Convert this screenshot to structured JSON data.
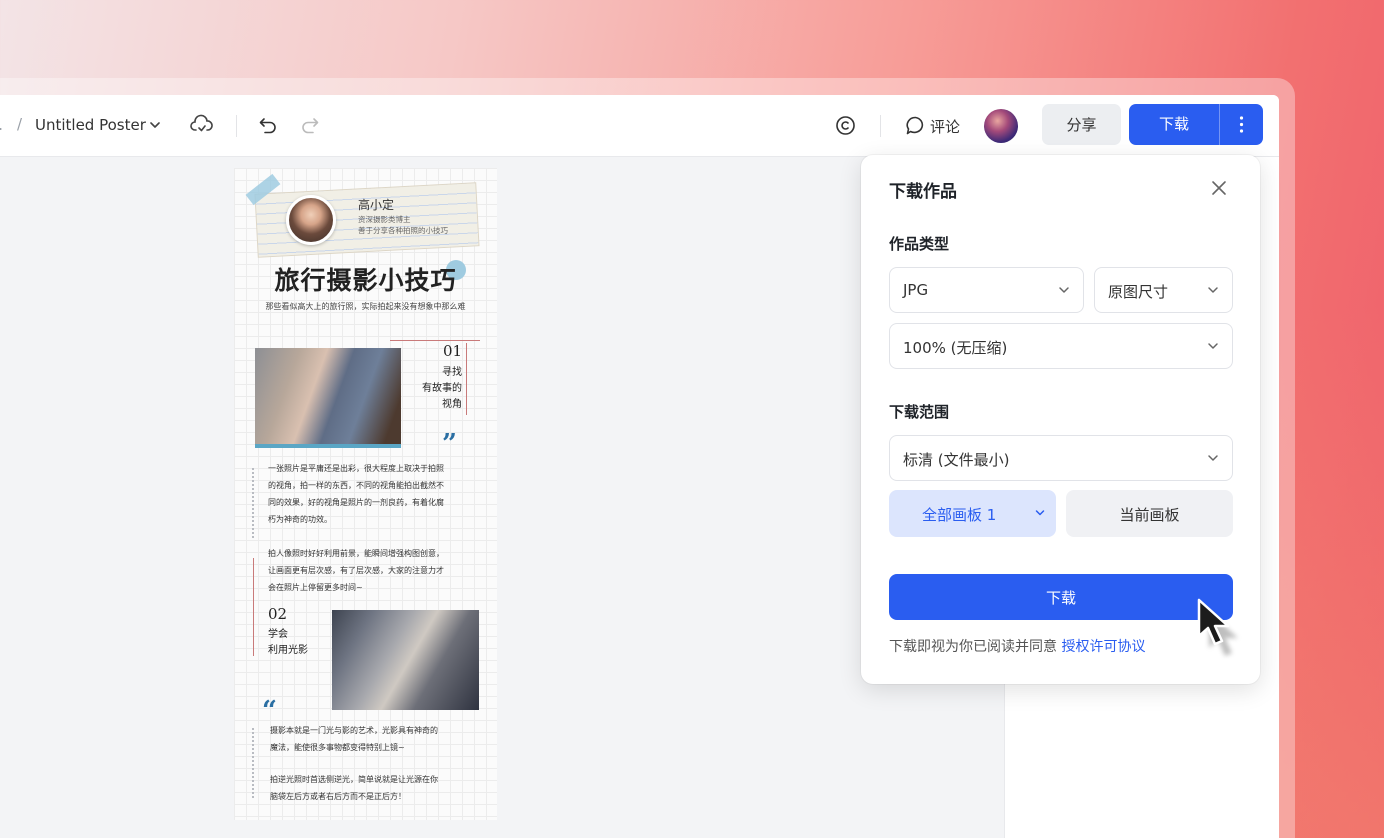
{
  "topbar": {
    "breadcrumb_prefix": ".",
    "breadcrumb_separator": "/",
    "document_title": "Untitled Poster",
    "comment_label": "评论",
    "share_label": "分享",
    "download_label": "下载"
  },
  "poster": {
    "author_name": "高小定",
    "author_line1": "资深摄影类博主",
    "author_line2": "善于分享各种拍照的小技巧",
    "title": "旅行摄影小技巧",
    "subtitle": "那些看似高大上的旅行照，实际拍起来没有想象中那么难",
    "section1": {
      "number": "01",
      "caption_lines": [
        "寻找",
        "有故事的",
        "视角"
      ]
    },
    "paragraph1": [
      "一张照片是平庸还是出彩，很大程度上取决于拍照",
      "的视角，拍一样的东西，不同的视角能拍出截然不",
      "同的效果，好的视角是照片的一剂良药，有着化腐",
      "朽为神奇的功效。"
    ],
    "paragraph2": [
      "拍人像照时好好利用前景，能瞬间增强构图创意，",
      "让画面更有层次感，有了层次感，大家的注意力才",
      "会在照片上停留更多时间~"
    ],
    "section2": {
      "number": "02",
      "caption_lines": [
        "学会",
        "利用光影"
      ]
    },
    "paragraph3": [
      "摄影本就是一门光与影的艺术，光影具有神奇的",
      "魔法，能使很多事物都变得特别上镜~"
    ],
    "paragraph4": [
      "拍逆光照时首选侧逆光，简单说就是让光源在你",
      "脑袋左后方或者右后方而不是正后方！"
    ],
    "quote_close": "”",
    "quote_open": "“"
  },
  "download_popup": {
    "title": "下载作品",
    "type_section": "作品类型",
    "format_value": "JPG",
    "size_value": "原图尺寸",
    "quality_value": "100% (无压缩)",
    "range_section": "下载范围",
    "resolution_value": "标清 (文件最小)",
    "all_boards_label": "全部画板 1",
    "current_board_label": "当前画板",
    "download_button": "下载",
    "agreement_text": "下载即视为你已阅读并同意",
    "agreement_link": "授权许可协议"
  },
  "colors": {
    "accent": "#2a5df0",
    "accent_light": "#dce5fd",
    "background_gradient_end": "#ef5f6b"
  },
  "icons": [
    "chevron-down-icon",
    "cloud-sync-icon",
    "undo-icon",
    "redo-icon",
    "copyright-icon",
    "comment-icon",
    "more-vertical-icon",
    "close-icon",
    "mouse-cursor-icon"
  ]
}
